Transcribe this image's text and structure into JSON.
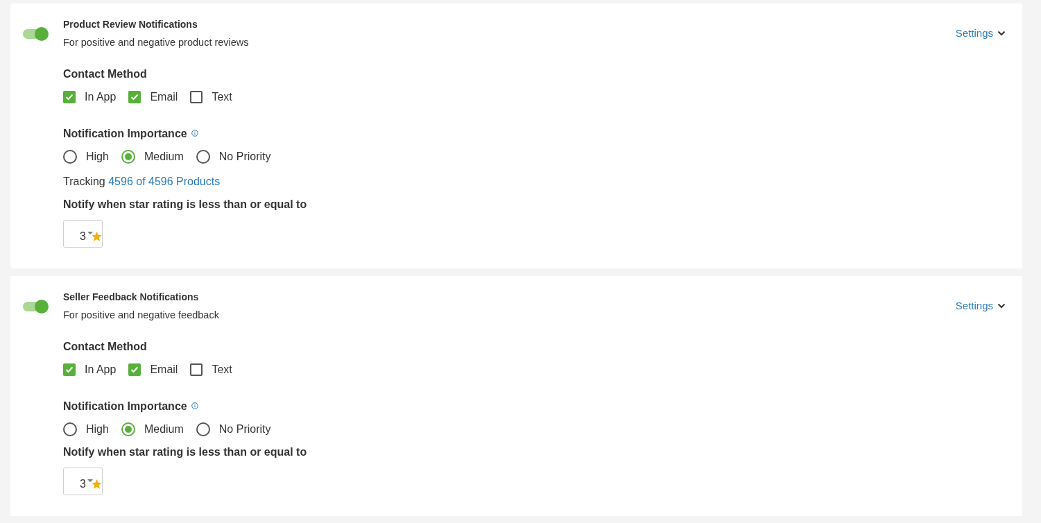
{
  "notification_sections": [
    {
      "enabled": true,
      "title": "Product Review Notifications",
      "description": "For positive and negative product reviews",
      "settings_link": "Settings",
      "contact_method": {
        "label": "Contact Method",
        "options": [
          {
            "label": "In App",
            "checked": true
          },
          {
            "label": "Email",
            "checked": true
          },
          {
            "label": "Text",
            "checked": false
          }
        ]
      },
      "importance": {
        "label": "Notification Importance",
        "options": [
          {
            "label": "High",
            "selected": false
          },
          {
            "label": "Medium",
            "selected": true
          },
          {
            "label": "No Priority",
            "selected": false
          }
        ]
      },
      "tracking": {
        "label": "Tracking",
        "link": "4596 of 4596 Products"
      },
      "rating_threshold": {
        "label": "Notify when star rating is less than or equal to",
        "value": "3"
      }
    },
    {
      "enabled": true,
      "title": "Seller Feedback Notifications",
      "description": "For positive and negative feedback",
      "settings_link": "Settings",
      "contact_method": {
        "label": "Contact Method",
        "options": [
          {
            "label": "In App",
            "checked": true
          },
          {
            "label": "Email",
            "checked": true
          },
          {
            "label": "Text",
            "checked": false
          }
        ]
      },
      "importance": {
        "label": "Notification Importance",
        "options": [
          {
            "label": "High",
            "selected": false
          },
          {
            "label": "Medium",
            "selected": true
          },
          {
            "label": "No Priority",
            "selected": false
          }
        ]
      },
      "rating_threshold": {
        "label": "Notify when star rating is less than or equal to",
        "value": "3"
      }
    }
  ]
}
